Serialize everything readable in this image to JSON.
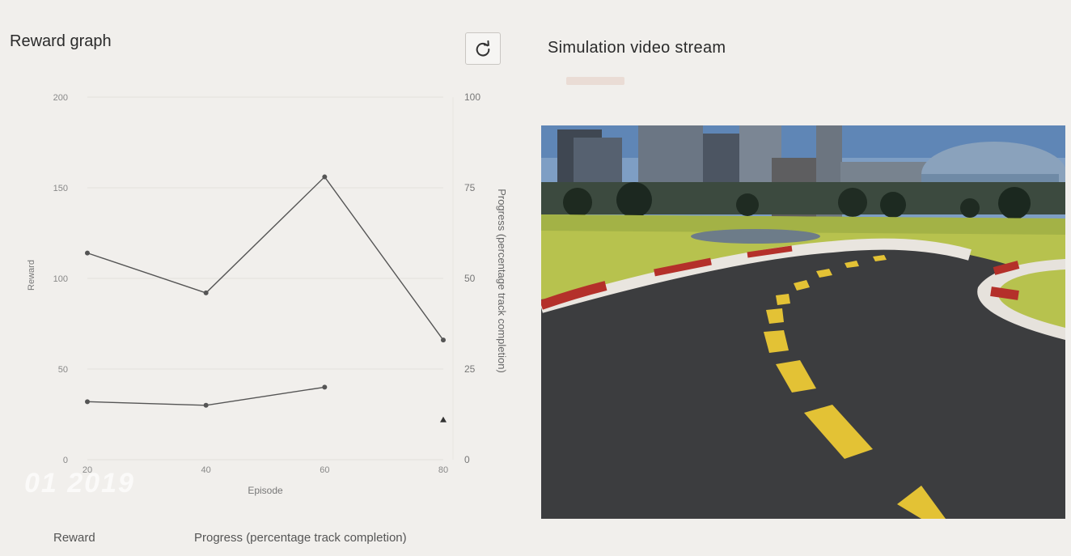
{
  "reward_panel": {
    "title": "Reward graph",
    "refresh_icon": "refresh-icon",
    "legend": {
      "reward": "Reward",
      "progress": "Progress (percentage track completion)"
    }
  },
  "video_panel": {
    "title": "Simulation video stream"
  },
  "watermark": {
    "date": "01 2019"
  },
  "chart_data": {
    "type": "line",
    "xlabel": "Episode",
    "ylabel": "Reward",
    "y2label": "Progress (percentage track completion)",
    "x_ticks": [
      "20",
      "40",
      "60",
      "80"
    ],
    "y_ticks": [
      "0",
      "50",
      "100",
      "150",
      "200"
    ],
    "y2_ticks": [
      "0",
      "25",
      "50",
      "75",
      "100"
    ],
    "xlim": [
      20,
      80
    ],
    "ylim": [
      0,
      200
    ],
    "y2lim": [
      0,
      100
    ],
    "series": [
      {
        "name": "Reward",
        "axis": "left",
        "x": [
          20,
          40,
          60,
          80
        ],
        "y": [
          114,
          92,
          156,
          66
        ]
      },
      {
        "name": "Progress (percentage track completion)",
        "axis": "right",
        "x": [
          20,
          40,
          60
        ],
        "y": [
          16,
          15,
          20
        ]
      },
      {
        "name": "Progress (percentage track completion)",
        "axis": "right",
        "x": [
          80
        ],
        "y": [
          11
        ]
      }
    ],
    "grid": true
  },
  "colors": {
    "line": "#555555",
    "grid": "#e2e0dc",
    "background": "#f1efec"
  }
}
